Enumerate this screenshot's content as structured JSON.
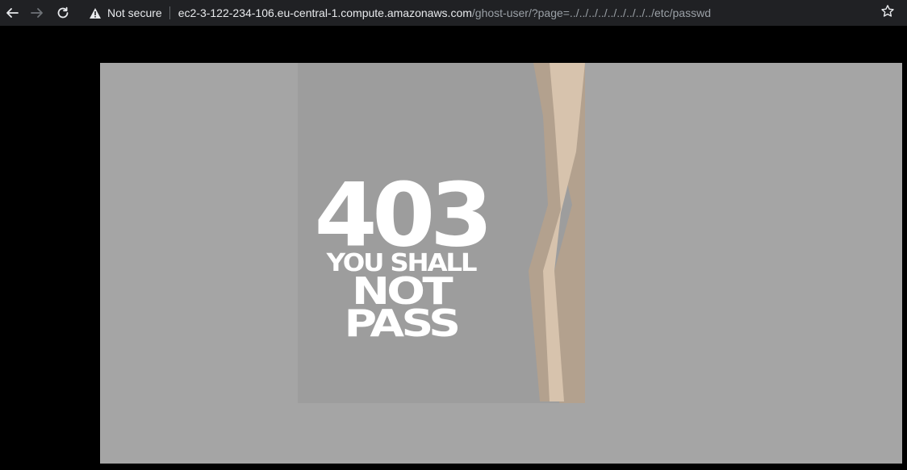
{
  "browser": {
    "back_icon": "arrow-left-icon",
    "forward_icon": "arrow-right-icon",
    "reload_icon": "reload-icon",
    "security_icon": "warning-triangle-icon",
    "security_label": "Not secure",
    "url_host": "ec2-3-122-234-106.eu-central-1.compute.amazonaws.com",
    "url_path": "/ghost-user/?page=../../../../../../../../../etc/passwd",
    "bookmark_icon": "star-icon"
  },
  "page": {
    "error_code": "403",
    "line1": "YOU SHALL",
    "line2": "NOT",
    "line3": "PASS"
  },
  "colors": {
    "toolbar_bg": "#202124",
    "page_bg": "#000000",
    "image_bg": "#a5a5a5",
    "poster_bg": "#9d9d9d",
    "crack_light": "#d7c3ad",
    "crack_dark": "#b3a18e"
  }
}
